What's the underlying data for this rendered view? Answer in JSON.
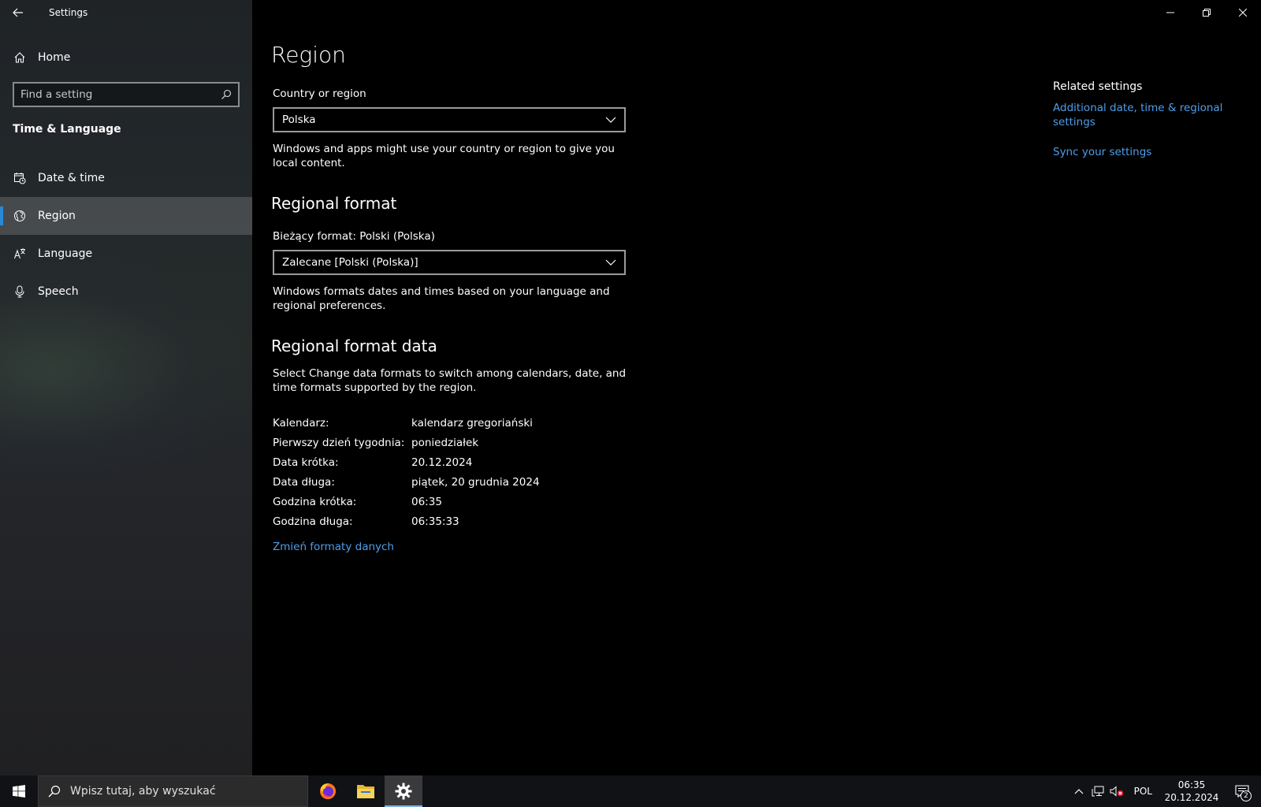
{
  "window": {
    "title": "Settings",
    "controls": [
      "minimize",
      "restore",
      "close"
    ]
  },
  "sidebar": {
    "home_label": "Home",
    "search_placeholder": "Find a setting",
    "section_title": "Time & Language",
    "items": [
      {
        "label": "Date & time",
        "icon": "calendar-clock-icon",
        "active": false
      },
      {
        "label": "Region",
        "icon": "globe-icon",
        "active": true
      },
      {
        "label": "Language",
        "icon": "language-icon",
        "active": false
      },
      {
        "label": "Speech",
        "icon": "microphone-icon",
        "active": false
      }
    ],
    "accent": "#2b88d8"
  },
  "main": {
    "page_title": "Region",
    "country": {
      "label": "Country or region",
      "value": "Polska",
      "description": "Windows and apps might use your country or region to give you local content."
    },
    "regional_format": {
      "heading": "Regional format",
      "current_label": "Bieżący format: Polski (Polska)",
      "value": "Zalecane [Polski (Polska)]",
      "description": "Windows formats dates and times based on your language and regional preferences."
    },
    "format_data": {
      "heading": "Regional format data",
      "description": "Select Change data formats to switch among calendars, date, and time formats supported by the region.",
      "rows": [
        {
          "key": "Kalendarz:",
          "value": "kalendarz gregoriański"
        },
        {
          "key": "Pierwszy dzień tygodnia:",
          "value": "poniedziałek"
        },
        {
          "key": "Data krótka:",
          "value": "20.12.2024"
        },
        {
          "key": "Data długa:",
          "value": "piątek, 20 grudnia 2024"
        },
        {
          "key": "Godzina krótka:",
          "value": "06:35"
        },
        {
          "key": "Godzina długa:",
          "value": "06:35:33"
        }
      ],
      "change_link": "Zmień formaty danych"
    },
    "related": {
      "title": "Related settings",
      "links": [
        "Additional date, time & regional settings",
        "Sync your settings"
      ]
    },
    "link_color": "#4f9ee8"
  },
  "taskbar": {
    "search_placeholder": "Wpisz tutaj, aby wyszukać",
    "apps": [
      "firefox-icon",
      "file-explorer-icon",
      "settings-gear-icon"
    ],
    "tray": {
      "language": "POL",
      "time": "06:35",
      "date": "20.12.2024",
      "notification_count": "2"
    }
  }
}
